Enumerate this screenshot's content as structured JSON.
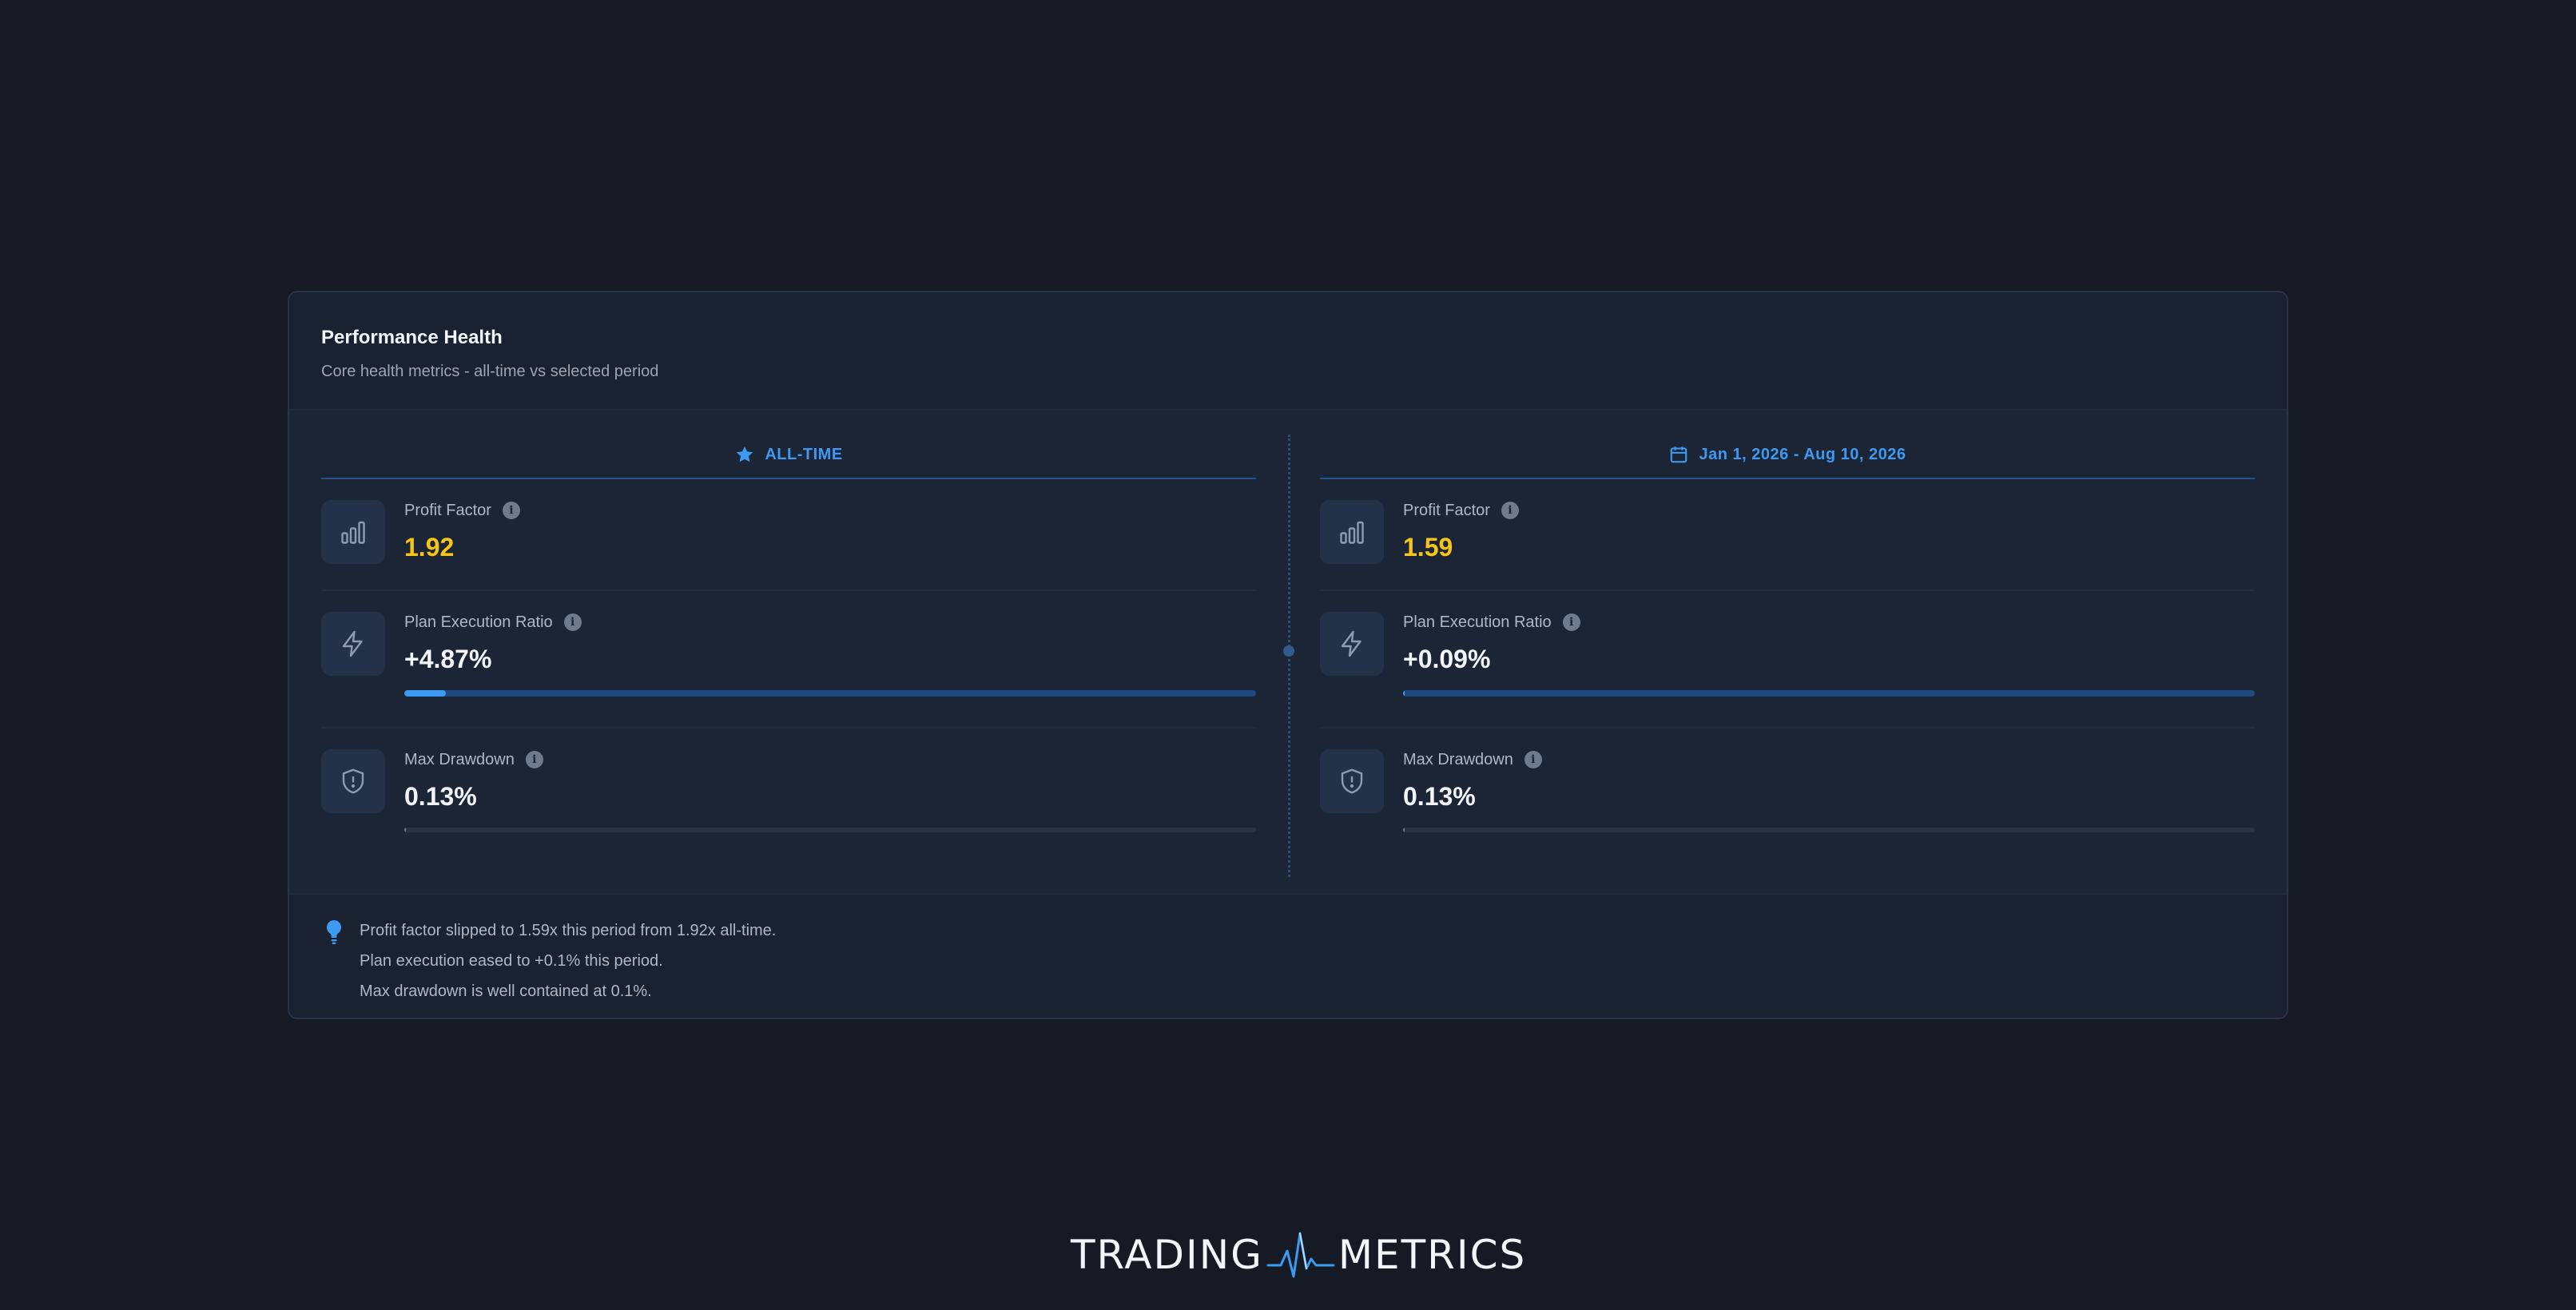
{
  "card": {
    "title": "Performance Health",
    "subtitle": "Core health metrics - all-time vs selected period"
  },
  "columns": [
    {
      "header": "ALL-TIME",
      "header_icon": "star-icon",
      "metrics": [
        {
          "label": "Profit Factor",
          "value": "1.92",
          "icon": "bar-chart-icon"
        },
        {
          "label": "Plan Execution Ratio",
          "value": "+4.87%",
          "icon": "lightning-icon",
          "bar_fraction": 0.0487
        },
        {
          "label": "Max Drawdown",
          "value": "0.13%",
          "icon": "shield-alert-icon",
          "bar_fraction": 0.0013
        }
      ]
    },
    {
      "header": "Jan 1, 2026 - Aug 10, 2026",
      "header_icon": "calendar-icon",
      "metrics": [
        {
          "label": "Profit Factor",
          "value": "1.59",
          "icon": "bar-chart-icon"
        },
        {
          "label": "Plan Execution Ratio",
          "value": "+0.09%",
          "icon": "lightning-icon",
          "bar_fraction": 0.0009
        },
        {
          "label": "Max Drawdown",
          "value": "0.13%",
          "icon": "shield-alert-icon",
          "bar_fraction": 0.0013
        }
      ]
    }
  ],
  "insights": [
    "Profit factor slipped to 1.59x this period from 1.92x all-time.",
    "Plan execution eased to +0.1% this period.",
    "Max drawdown is well contained at 0.1%."
  ],
  "brand": {
    "left": "TRADING",
    "right": "METRICS"
  },
  "colors": {
    "accent": "#3d9af0",
    "gold": "#f5c518",
    "background": "#161a24",
    "card": "#1a2232"
  }
}
